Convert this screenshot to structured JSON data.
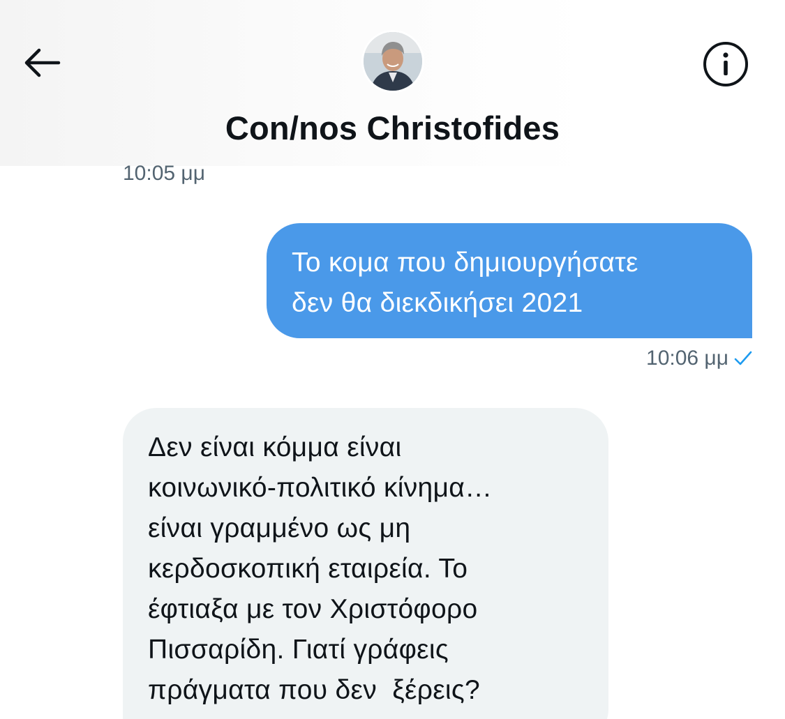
{
  "header": {
    "contact_name": "Con/nos Christofides",
    "back_icon": "arrow-left-icon",
    "info_icon": "info-circle-icon"
  },
  "conversation": {
    "previous_timestamp": "10:05 μμ",
    "sent_message": {
      "lines": [
        "Το κομα που δημιουργήσατε",
        "δεν θα διεκδικήσει 2021"
      ],
      "timestamp": "10:06 μμ",
      "status_icon": "check-icon"
    },
    "received_message": {
      "lines": [
        "Δεν είναι κόμμα είναι",
        "κοινωνικό-πολιτικό κίνημα…",
        "είναι γραμμένο ως μη",
        "κερδοσκοπική εταιρεία. Το",
        "έφτιαξα με τον Χριστόφορο",
        "Πισσαρίδη. Γιατί γράφεις",
        "πράγματα που δεν  ξέρεις?"
      ]
    }
  },
  "colors": {
    "sent_bubble": "#4a99e9",
    "received_bubble": "#eff3f4",
    "meta_text": "#536471",
    "accent": "#1d9bf0"
  }
}
